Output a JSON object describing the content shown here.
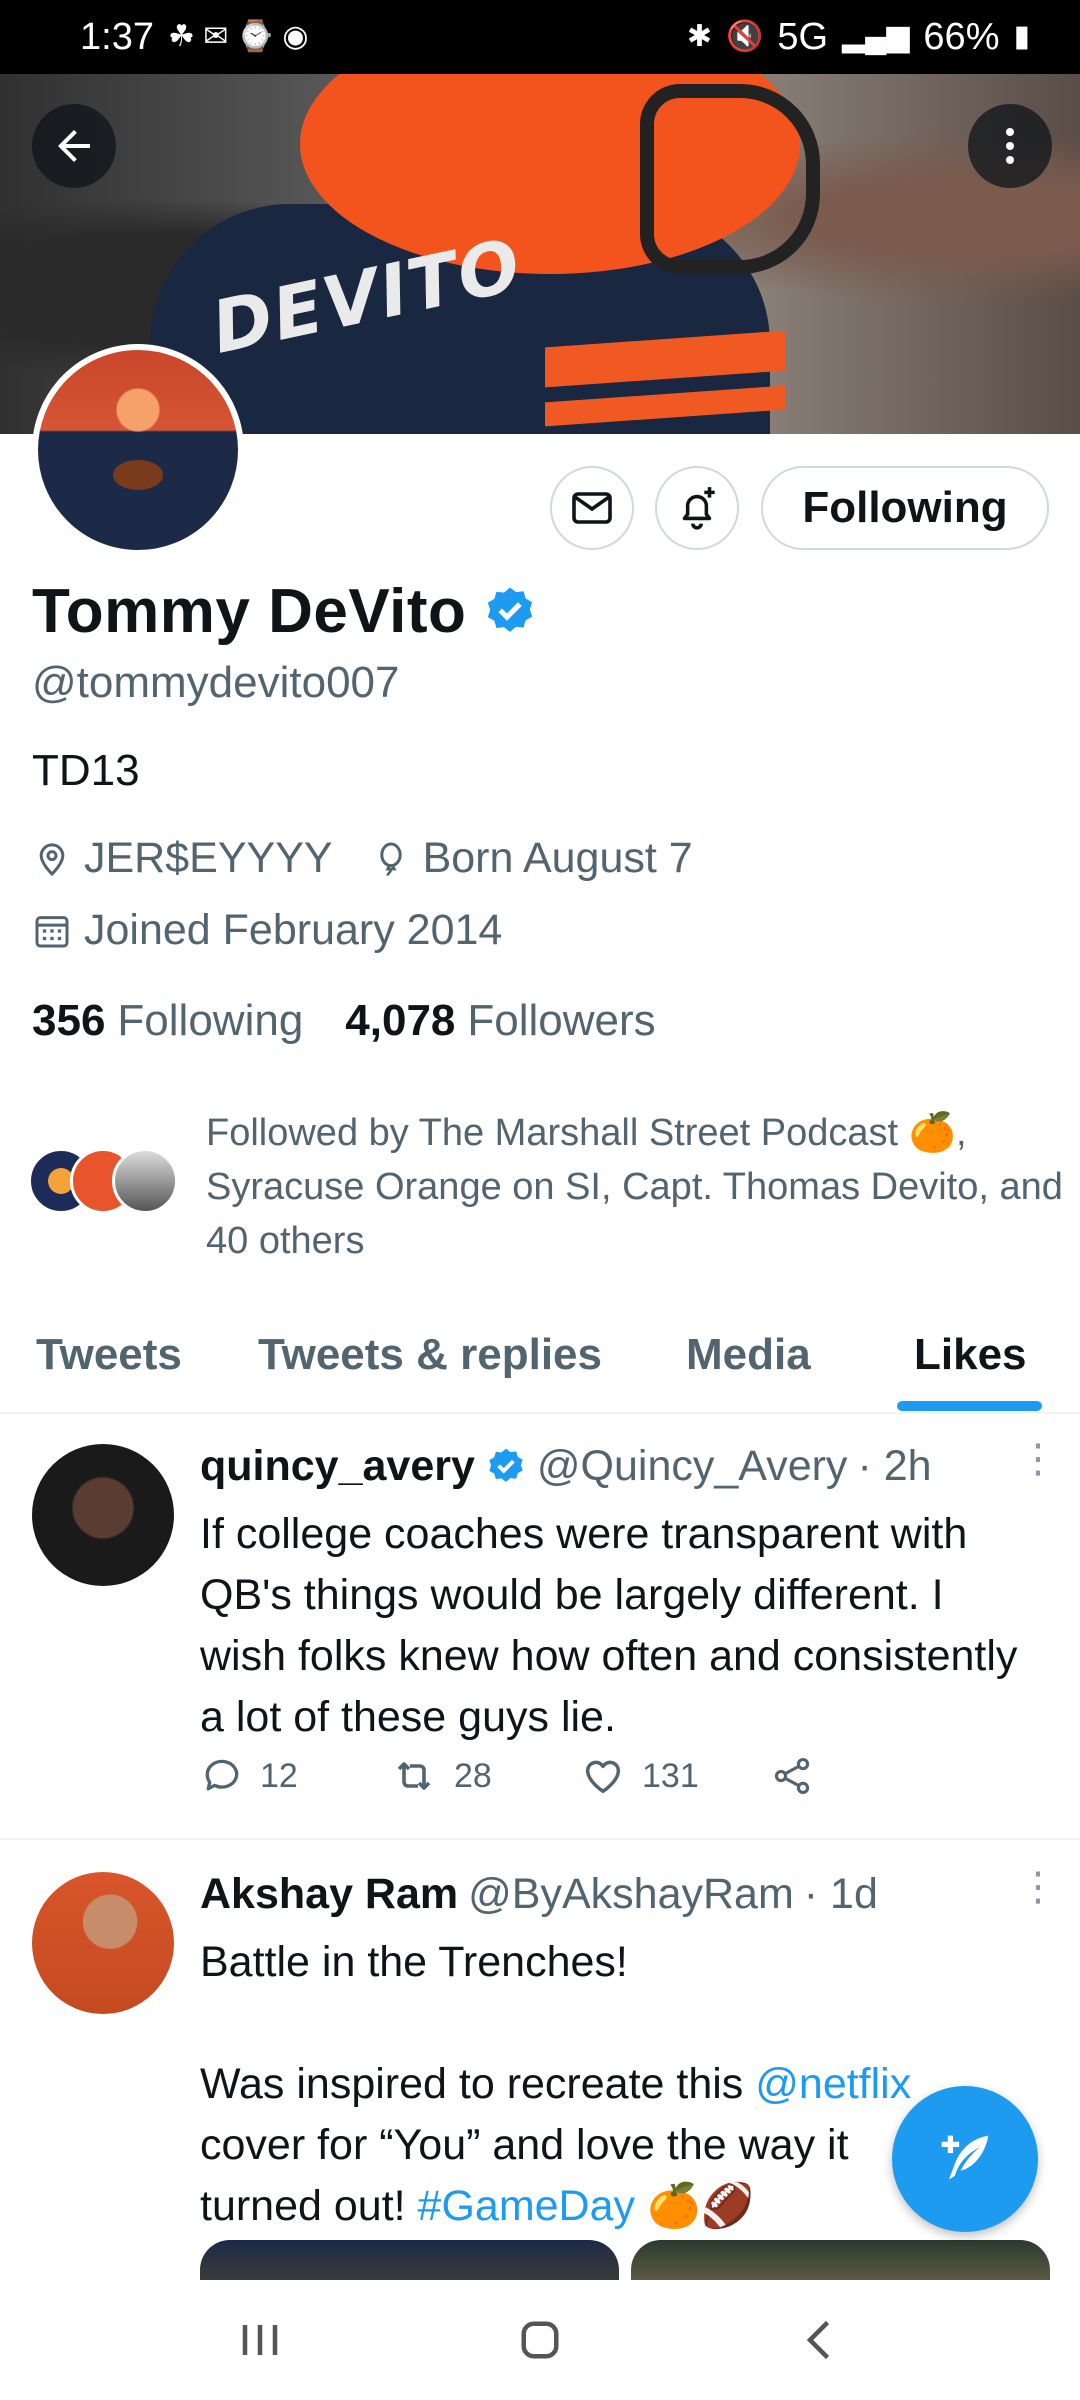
{
  "status_bar": {
    "time": "1:37",
    "network": "5G",
    "battery": "66%"
  },
  "banner": {
    "jersey_text": "DEVITO"
  },
  "profile": {
    "name": "Tommy DeVito",
    "handle": "@tommydevito007",
    "bio": "TD13",
    "location": "JER$EYYYY",
    "birthday": "Born August 7",
    "joined": "Joined February 2014",
    "following_count": "356",
    "following_label": "Following",
    "followers_count": "4,078",
    "followers_label": "Followers",
    "followed_by": "Followed by The Marshall Street Podcast 🍊, Syracuse Orange on SI, Capt. Thomas Devito, and 40 others",
    "follow_button_label": "Following"
  },
  "tabs": [
    {
      "label": "Tweets",
      "active": false
    },
    {
      "label": "Tweets & replies",
      "active": false
    },
    {
      "label": "Media",
      "active": false
    },
    {
      "label": "Likes",
      "active": true
    }
  ],
  "tweets": [
    {
      "name": "quincy_avery",
      "verified": true,
      "handle": "@Quincy_Avery",
      "time": "· 2h",
      "text": "If college coaches were transparent with QB's things would be largely different. I wish folks knew how often and consistently a lot of these guys lie.",
      "replies": "12",
      "retweets": "28",
      "likes": "131"
    },
    {
      "name": "Akshay Ram",
      "verified": false,
      "handle": "@ByAkshayRam",
      "time": "· 1d",
      "line1": "Battle in the Trenches!",
      "line2_pre": "Was inspired to recreate this ",
      "mention": "@netflix",
      "line3": "cover for “You” and love the way it",
      "line4_pre": "turned out! ",
      "hashtag": "#GameDay",
      "line4_post": " 🍊🏈"
    }
  ],
  "colors": {
    "accent": "#1d9bf0",
    "text_primary": "#0f1419",
    "text_secondary": "#536471",
    "divider": "#eff3f4"
  }
}
